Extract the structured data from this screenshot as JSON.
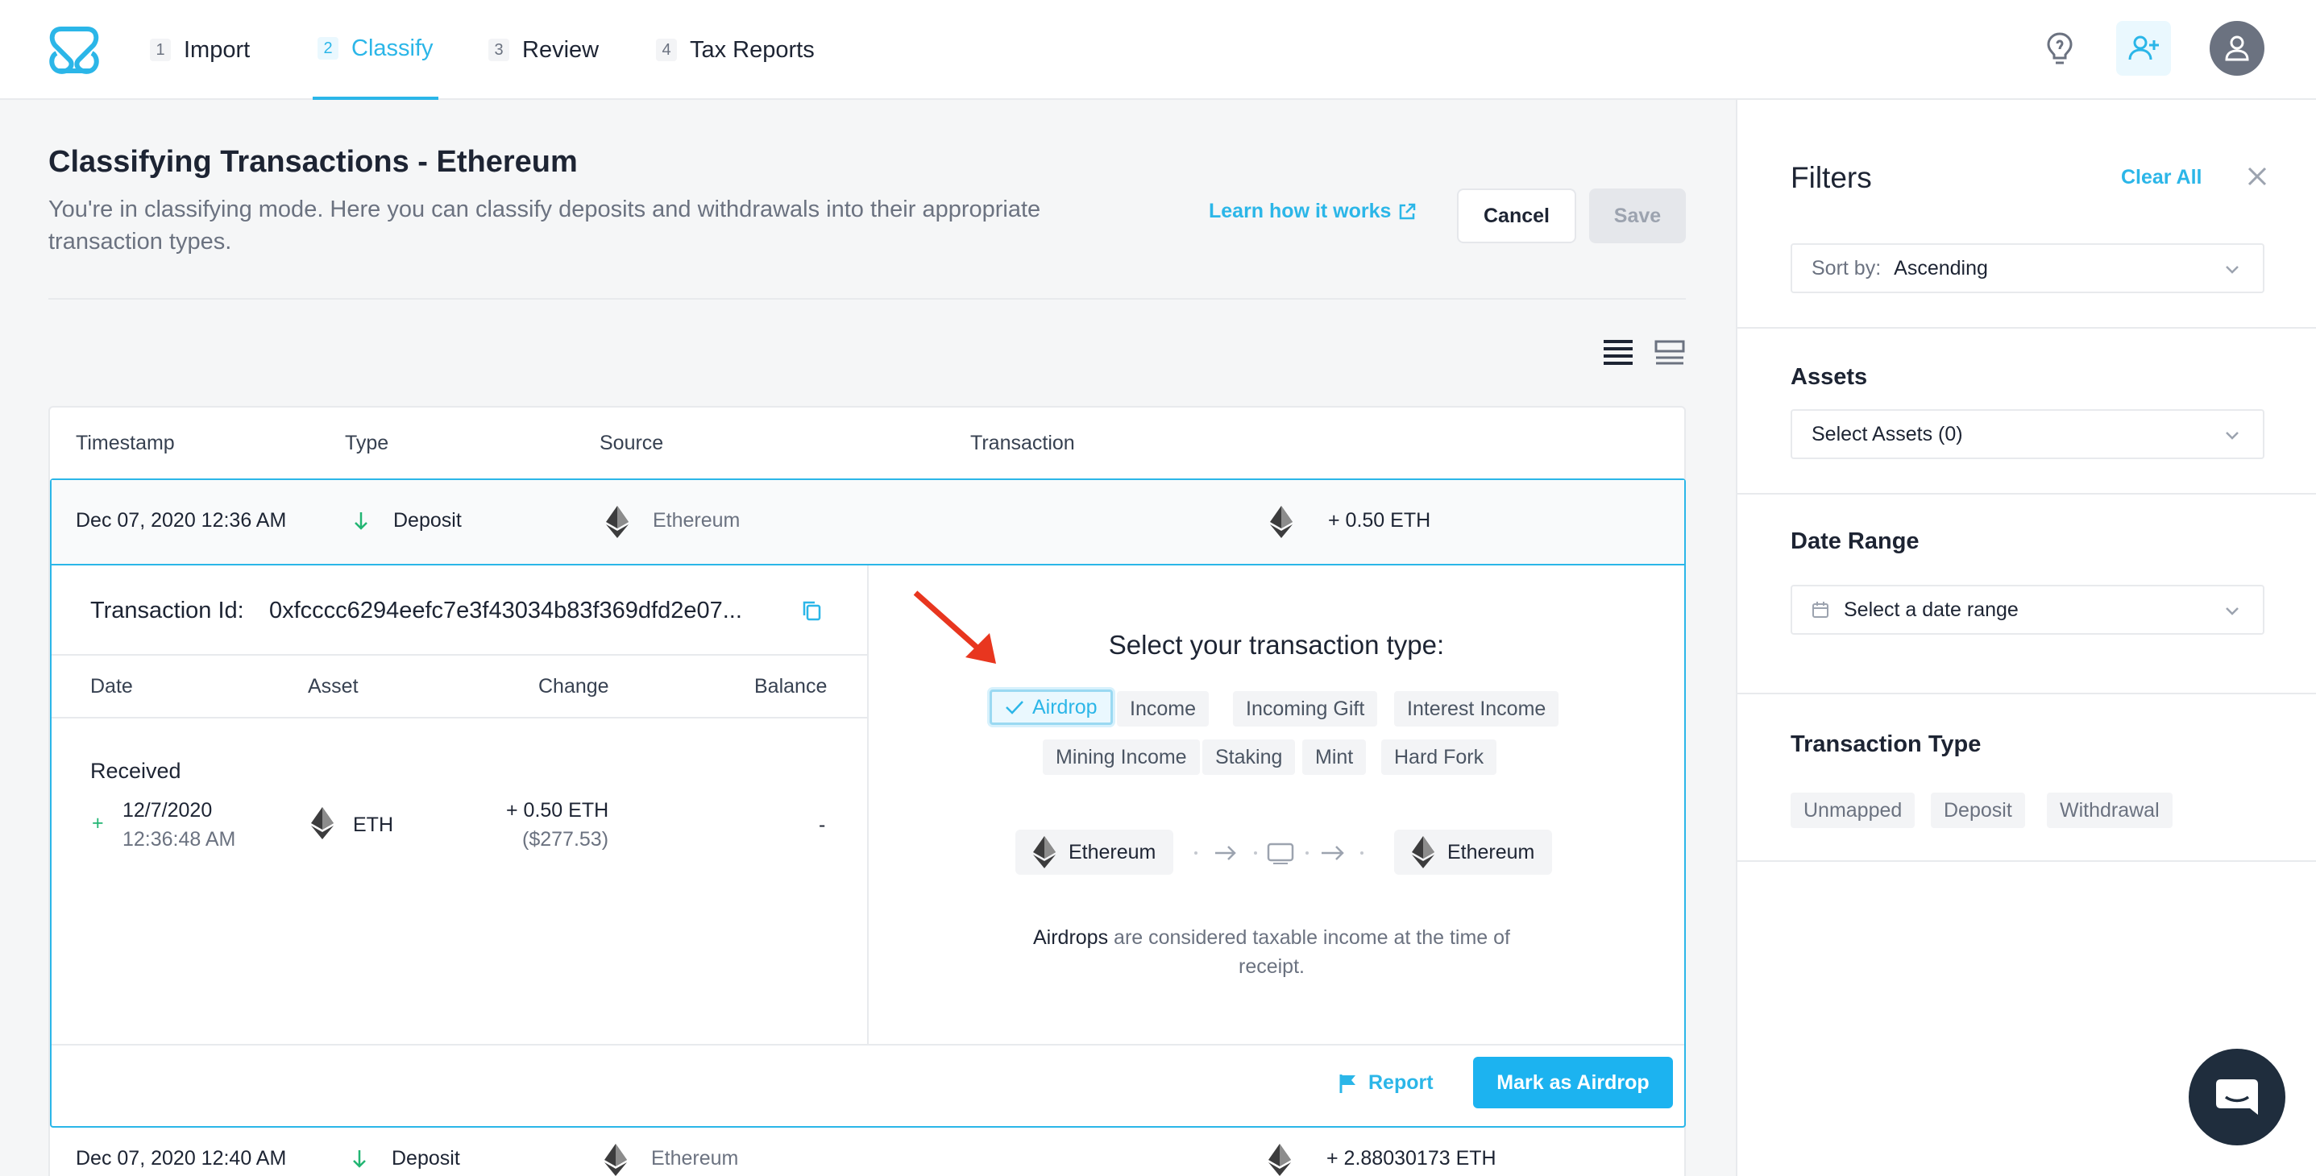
{
  "nav": {
    "steps": [
      {
        "num": "1",
        "label": "Import"
      },
      {
        "num": "2",
        "label": "Classify"
      },
      {
        "num": "3",
        "label": "Review"
      },
      {
        "num": "4",
        "label": "Tax Reports"
      }
    ],
    "active_step": "Classify"
  },
  "header": {
    "title": "Classifying Transactions - Ethereum",
    "description": "You're in classifying mode. Here you can classify deposits and withdrawals into their appropriate transaction types.",
    "learn_link": "Learn how it works",
    "cancel_label": "Cancel",
    "save_label": "Save"
  },
  "table": {
    "headers": [
      "Timestamp",
      "Type",
      "Source",
      "Transaction"
    ],
    "rows": [
      {
        "timestamp": "Dec 07, 2020 12:36 AM",
        "type": "Deposit",
        "source": "Ethereum",
        "transaction": "+ 0.50 ETH"
      },
      {
        "timestamp": "Dec 07, 2020 12:40 AM",
        "type": "Deposit",
        "source": "Ethereum",
        "transaction": "+ 2.88030173 ETH"
      }
    ]
  },
  "detail": {
    "txid_label": "Transaction Id:",
    "txid_value": "0xfcccc6294eefc7e3f43034b83f369dfd2e07...",
    "headers": [
      "Date",
      "Asset",
      "Change",
      "Balance"
    ],
    "group_label": "Received",
    "entry": {
      "date": "12/7/2020",
      "time": "12:36:48 AM",
      "asset": "ETH",
      "change": "+ 0.50 ETH",
      "change_usd": "($277.53)",
      "balance": "-"
    }
  },
  "classify": {
    "title": "Select your transaction type:",
    "types_row1": [
      "Airdrop",
      "Income",
      "Incoming Gift",
      "Interest Income"
    ],
    "types_row2": [
      "Mining Income",
      "Staking",
      "Mint",
      "Hard Fork"
    ],
    "selected": "Airdrop",
    "flow_from": "Ethereum",
    "flow_to": "Ethereum",
    "note_bold": "Airdrops",
    "note_rest": " are considered taxable income at the time of receipt.",
    "report_label": "Report",
    "mark_label": "Mark as Airdrop"
  },
  "filters": {
    "title": "Filters",
    "clear_all": "Clear All",
    "sort_label": "Sort by:",
    "sort_value": "Ascending",
    "assets_title": "Assets",
    "assets_value": "Select Assets (0)",
    "date_title": "Date Range",
    "date_value": "Select a date range",
    "txtype_title": "Transaction Type",
    "txtypes": [
      "Unmapped",
      "Deposit",
      "Withdrawal"
    ]
  },
  "colors": {
    "accent": "#2bb6e8",
    "primary_button": "#1cb3f0",
    "annotation_arrow": "#e8361f"
  }
}
